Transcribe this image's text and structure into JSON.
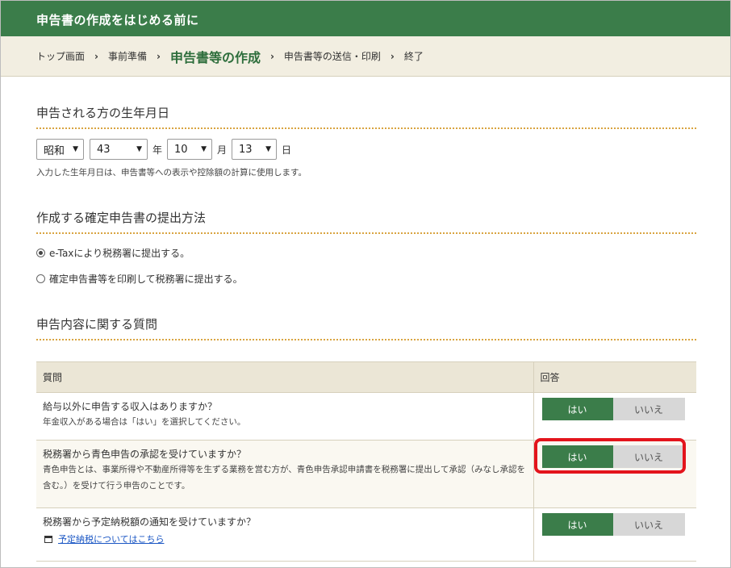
{
  "header": {
    "title": "申告書の作成をはじめる前に"
  },
  "breadcrumb": {
    "items": [
      "トップ画面",
      "事前準備",
      "申告書等の作成",
      "申告書等の送信・印刷",
      "終了"
    ],
    "separator": "›",
    "current_index": 2
  },
  "dob": {
    "section_title": "申告される方の生年月日",
    "era": "昭和",
    "year": "43",
    "year_unit": "年",
    "month": "10",
    "month_unit": "月",
    "day": "13",
    "day_unit": "日",
    "note": "入力した生年月日は、申告書等への表示や控除額の計算に使用します。"
  },
  "method": {
    "section_title": "作成する確定申告書の提出方法",
    "options": [
      {
        "label": "e-Taxにより税務署に提出する。",
        "selected": true
      },
      {
        "label": "確定申告書等を印刷して税務署に提出する。",
        "selected": false
      }
    ]
  },
  "questions": {
    "section_title": "申告内容に関する質問",
    "col_question": "質問",
    "col_answer": "回答",
    "yes_label": "はい",
    "no_label": "いいえ",
    "rows": [
      {
        "question": "給与以外に申告する収入はありますか？",
        "note": "年金収入がある場合は「はい」を選択してください。"
      },
      {
        "question": "税務署から青色申告の承認を受けていますか？",
        "note": "青色申告とは、事業所得や不動産所得等を生ずる業務を営む方が、青色申告承認申請書を税務署に提出して承認（みなし承認を含む。）を受けて行う申告のことです。"
      },
      {
        "question": "税務署から予定納税額の通知を受けていますか？",
        "link": "予定納税についてはこちら"
      }
    ]
  },
  "colors": {
    "brand_green": "#3b7d4a",
    "highlight_red": "#e3141c",
    "link_blue": "#1a56c4"
  }
}
